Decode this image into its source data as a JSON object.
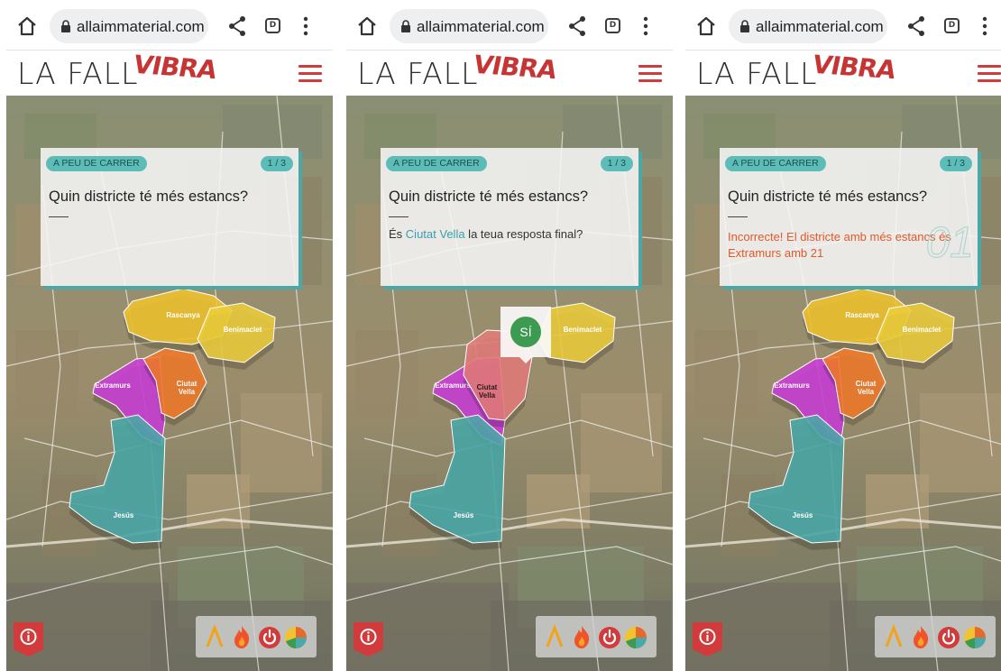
{
  "screens": [
    {
      "browser": {
        "url": "allaimmaterial.com",
        "tabs_count": "D"
      },
      "site": {
        "logo_text": "LA FALLA",
        "logo_accent": "VIBRA"
      },
      "card": {
        "tag": "A PEU DE CARRER",
        "count": "1 / 3",
        "question": "Quin districte té més estancs?",
        "answer_prefix": "",
        "answer_highlight": "",
        "answer_suffix": "",
        "result": "",
        "numeral": ""
      },
      "map": {
        "districts": [
          "Rascanya",
          "Benimaclet",
          "Extramurs",
          "Ciutat Vella",
          "Jesús"
        ],
        "selected": ""
      },
      "popup": null
    },
    {
      "browser": {
        "url": "allaimmaterial.com",
        "tabs_count": "D"
      },
      "site": {
        "logo_text": "LA FALLA",
        "logo_accent": "VIBRA"
      },
      "card": {
        "tag": "A PEU DE CARRER",
        "count": "1 / 3",
        "question": "Quin districte té més estancs?",
        "answer_prefix": "És ",
        "answer_highlight": "Ciutat Vella",
        "answer_suffix": " la teua resposta final?",
        "result": "",
        "numeral": ""
      },
      "map": {
        "districts": [
          "Benimaclet",
          "Extramurs",
          "Ciutat Vella",
          "Jesús"
        ],
        "selected": "Ciutat Vella"
      },
      "popup": {
        "label": "SÍ"
      }
    },
    {
      "browser": {
        "url": "allaimmaterial.com",
        "tabs_count": "D"
      },
      "site": {
        "logo_text": "LA FALLA",
        "logo_accent": "VIBRA"
      },
      "card": {
        "tag": "A PEU DE CARRER",
        "count": "1 / 3",
        "question": "Quin districte té més estancs?",
        "answer_prefix": "",
        "answer_highlight": "",
        "answer_suffix": "",
        "result": "Incorrecte! El districte amb més estancs és Extramurs amb 21",
        "numeral": "01"
      },
      "map": {
        "districts": [
          "Rascanya",
          "Benimaclet",
          "Extramurs",
          "Ciutat Vella",
          "Jesús"
        ],
        "selected": ""
      },
      "popup": null
    }
  ],
  "icons": {
    "home": "home-icon",
    "lock": "lock-icon",
    "share": "share-icon",
    "tabs": "tab-switcher-icon",
    "kebab": "more-vert-icon",
    "menu": "hamburger-menu-icon",
    "info": "info-icon",
    "tools": [
      "chevron-up-icon",
      "flame-icon",
      "power-icon",
      "pie-chart-icon"
    ]
  },
  "colors": {
    "brand_red": "#d23b3b",
    "teal": "#5cbcb8",
    "rascanya": "#f0c32e",
    "benimaclet": "#eccd3b",
    "extramurs": "#c93dd6",
    "ciutat_vella": "#f07a2a",
    "jesus": "#4aa9a8",
    "selected": "#e37c7a",
    "result_text": "#e05a2a",
    "si_green": "#3d9a51"
  }
}
